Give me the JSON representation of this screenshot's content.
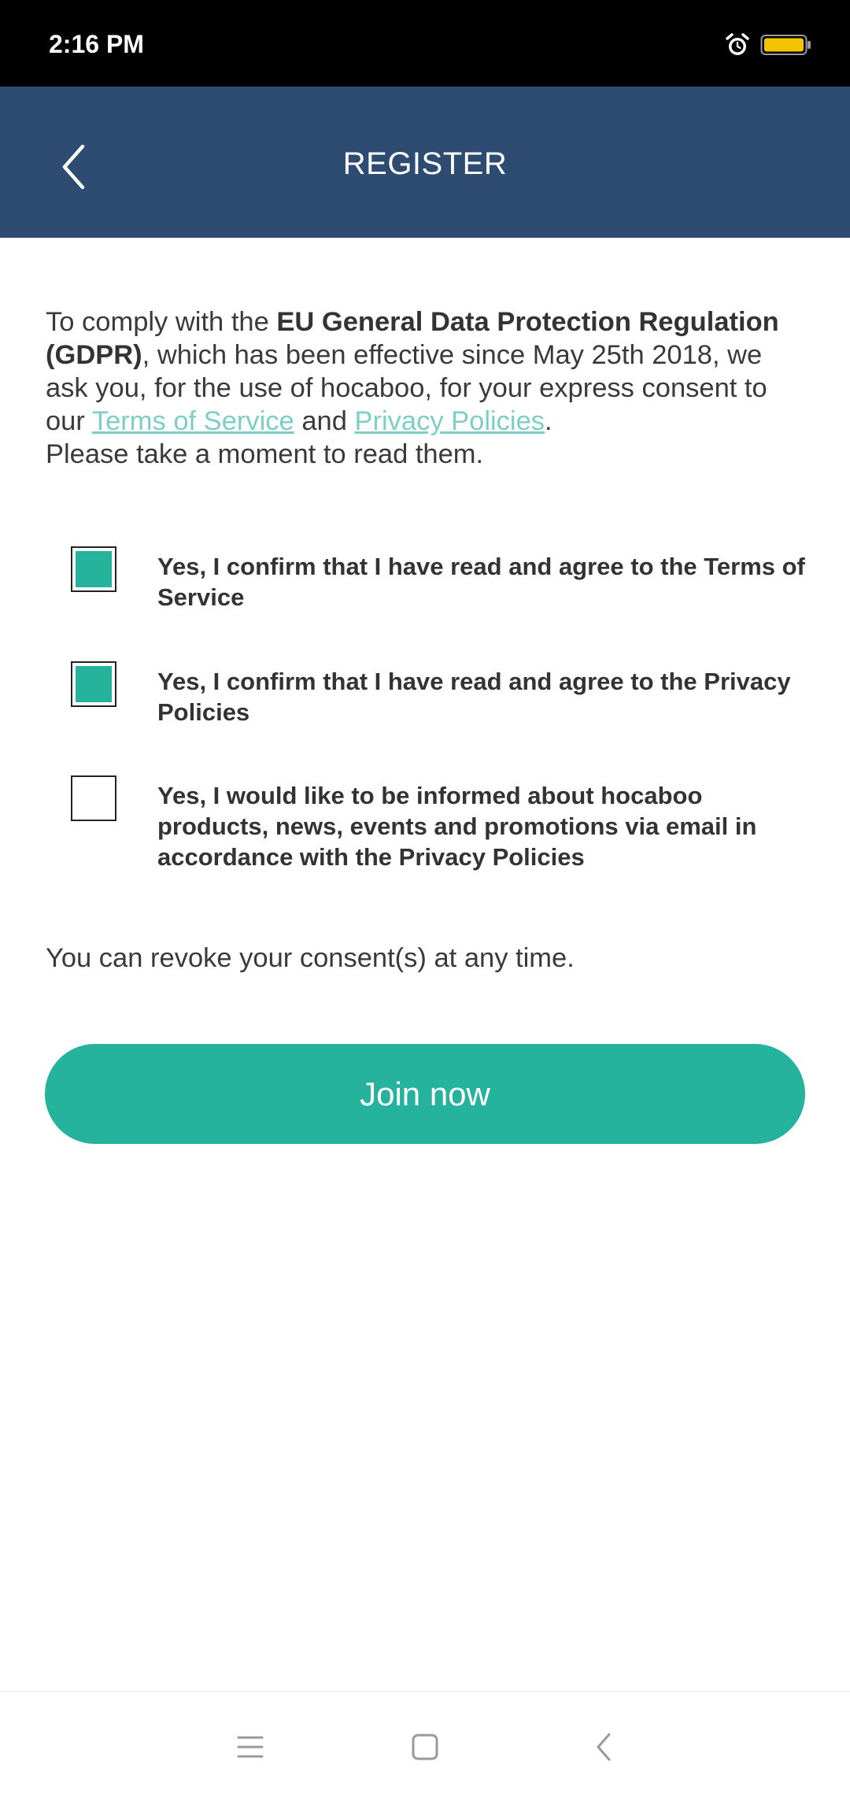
{
  "status_bar": {
    "time": "2:16 PM",
    "icons": [
      "alarm-icon",
      "battery-icon"
    ],
    "battery_color": "#f5c400"
  },
  "app_bar": {
    "title": "REGISTER",
    "back_icon": "chevron-left-icon",
    "background": "#2e4c71"
  },
  "intro": {
    "part1": "To comply with the ",
    "bold": "EU General Data Protection Regulation (GDPR)",
    "part2": ", which has been effective since May 25th 2018, we ask you, for the use of hocaboo, for your express consent to our ",
    "terms_link": "Terms of Service",
    "part3": " and ",
    "privacy_link": "Privacy Policies",
    "part4": ".",
    "part5": "Please take a moment to read them."
  },
  "consents": [
    {
      "label": "Yes, I confirm that I have read and agree to the Terms of Service",
      "checked": true
    },
    {
      "label": "Yes, I confirm that I have read and agree to the Privacy Policies",
      "checked": true
    },
    {
      "label": "Yes, I would like to be informed about hocaboo products, news, events and promotions via email in accordance with the Privacy Policies",
      "checked": false
    }
  ],
  "revoke_text": "You can revoke your consent(s) at any time.",
  "join_button": {
    "label": "Join now",
    "color": "#26b39e"
  },
  "nav_bar": {
    "icons": [
      "menu-icon",
      "home-square-icon",
      "back-icon"
    ]
  },
  "colors": {
    "accent": "#26b39e",
    "link": "#7dcfc4"
  }
}
